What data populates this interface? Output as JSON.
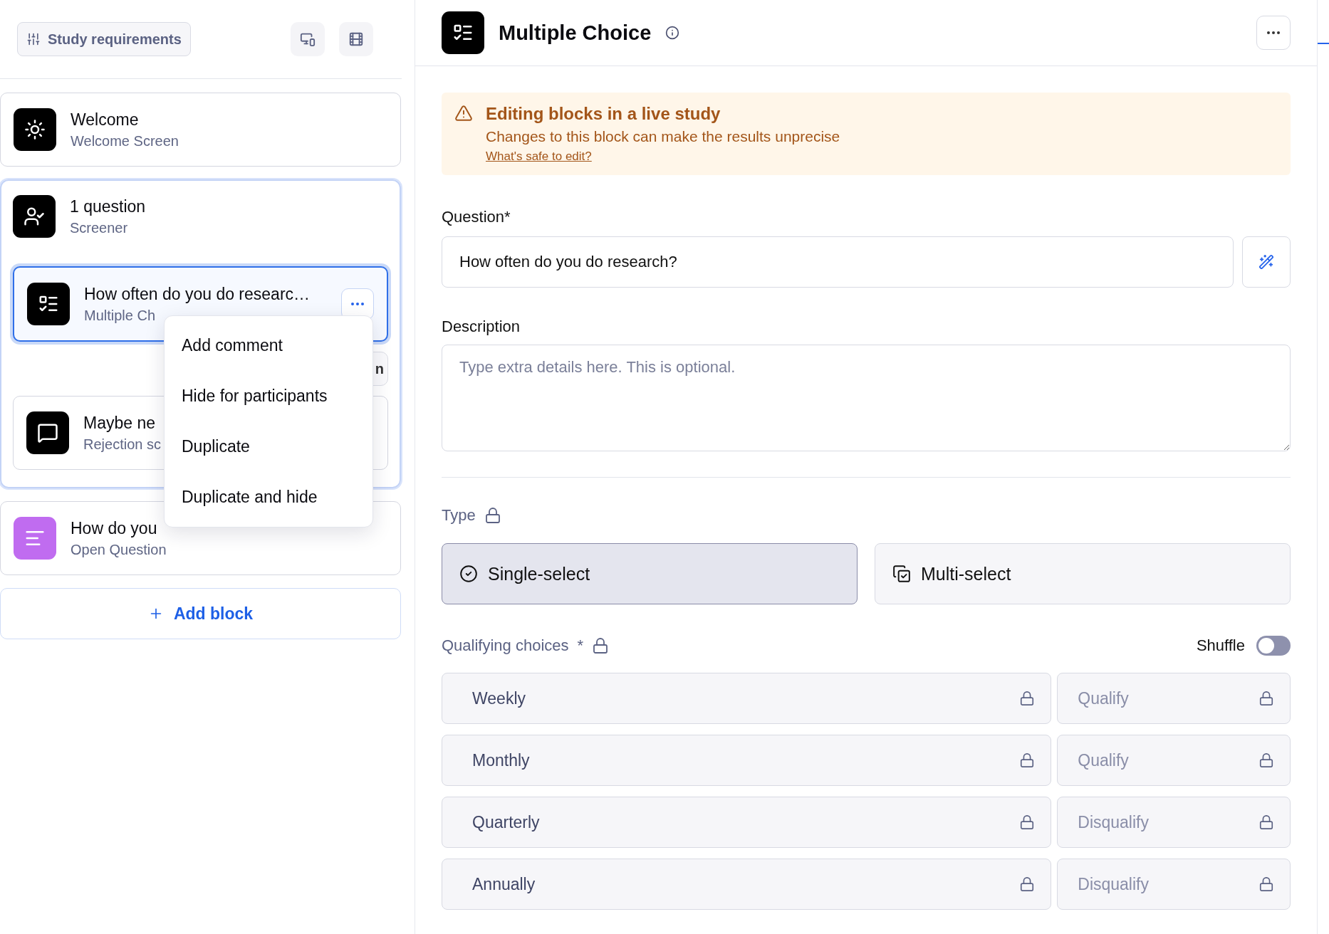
{
  "sidebar": {
    "requirements_button": "Study requirements",
    "blocks": [
      {
        "kind": "welcome",
        "title": "Welcome",
        "subtitle": "Welcome Screen",
        "selected": false
      },
      {
        "kind": "screener",
        "title": "1 question",
        "subtitle": "Screener",
        "selected": true,
        "children": [
          {
            "kind": "multiple_choice",
            "title": "How often do you do researc…",
            "subtitle": "Multiple Ch",
            "selected": true,
            "menu_open": true
          },
          {
            "kind": "button",
            "label": "n"
          },
          {
            "kind": "rejection",
            "title": "Maybe ne",
            "subtitle": "Rejection sc",
            "selected": false
          }
        ]
      },
      {
        "kind": "open_question",
        "title": "How do you",
        "subtitle": "Open Question",
        "selected": false
      }
    ],
    "add_block": "Add block"
  },
  "context_menu": {
    "items": [
      "Add comment",
      "Hide for participants",
      "Duplicate",
      "Duplicate and hide"
    ]
  },
  "editor": {
    "kind": "multiple_choice",
    "title": "Multiple Choice",
    "warning": {
      "title": "Editing blocks in a live study",
      "text": "Changes to this block can make the results unprecise",
      "link": "What's safe to edit?"
    },
    "question": {
      "label": "Question*",
      "value": "How often do you do research?"
    },
    "description": {
      "label": "Description",
      "placeholder": "Type extra details here. This is optional."
    },
    "type": {
      "label": "Type",
      "locked": true,
      "options": [
        {
          "kind": "single",
          "label": "Single-select",
          "selected": true
        },
        {
          "kind": "multi",
          "label": "Multi-select",
          "selected": false
        }
      ]
    },
    "choices": {
      "label": "Qualifying choices",
      "required_mark": "*",
      "locked": true,
      "shuffle": {
        "label": "Shuffle",
        "on": false
      },
      "items": [
        {
          "label": "Weekly",
          "rule": "Qualify",
          "locked": true
        },
        {
          "label": "Monthly",
          "rule": "Qualify",
          "locked": true
        },
        {
          "label": "Quarterly",
          "rule": "Disqualify",
          "locked": true
        },
        {
          "label": "Annually",
          "rule": "Disqualify",
          "locked": true
        }
      ]
    }
  }
}
